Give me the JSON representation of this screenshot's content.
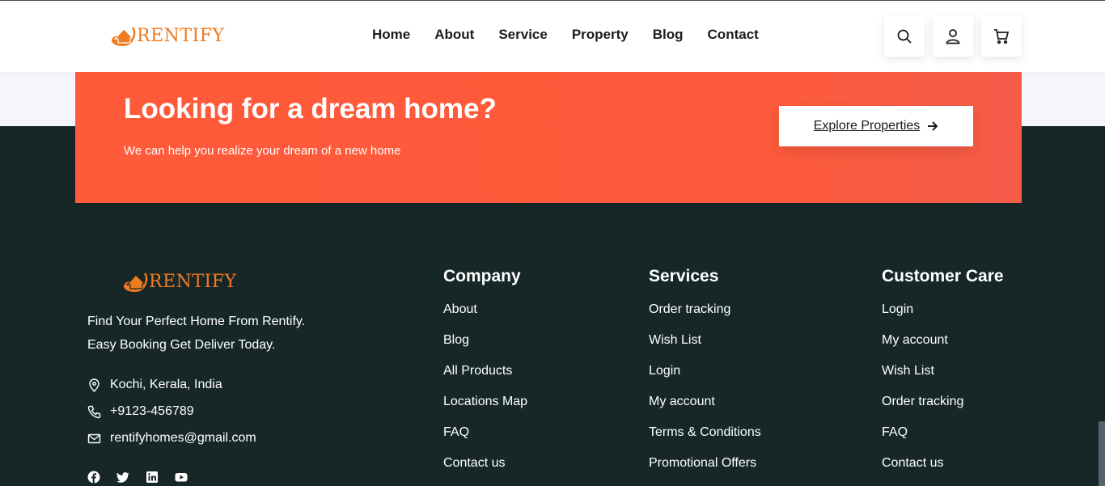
{
  "brand": {
    "logo_text": "RENTIFY",
    "accent": "#f07a1e"
  },
  "nav": [
    "Home",
    "About",
    "Service",
    "Property",
    "Blog",
    "Contact"
  ],
  "header_icons": [
    "search-icon",
    "user-icon",
    "cart-icon"
  ],
  "banner": {
    "title": "Looking for a dream home?",
    "subtitle": "We can help you realize your dream of a new home",
    "button_label": "Explore Properties",
    "color": "#fd5b3c"
  },
  "footer": {
    "about_lines": [
      "Find Your Perfect Home From Rentify.",
      "Easy Booking Get Deliver Today."
    ],
    "contact": {
      "address": "Kochi, Kerala, India",
      "phone": "+9123-456789",
      "email": "rentifyhomes@gmail.com"
    },
    "social_icons": [
      "facebook-icon",
      "twitter-icon",
      "linkedin-icon",
      "youtube-icon"
    ],
    "columns": [
      {
        "title": "Company",
        "items": [
          "About",
          "Blog",
          "All Products",
          "Locations Map",
          "FAQ",
          "Contact us"
        ]
      },
      {
        "title": "Services",
        "items": [
          "Order tracking",
          "Wish List",
          "Login",
          "My account",
          "Terms & Conditions",
          "Promotional Offers"
        ]
      },
      {
        "title": "Customer Care",
        "items": [
          "Login",
          "My account",
          "Wish List",
          "Order tracking",
          "FAQ",
          "Contact us"
        ]
      }
    ],
    "background": "#172727"
  }
}
